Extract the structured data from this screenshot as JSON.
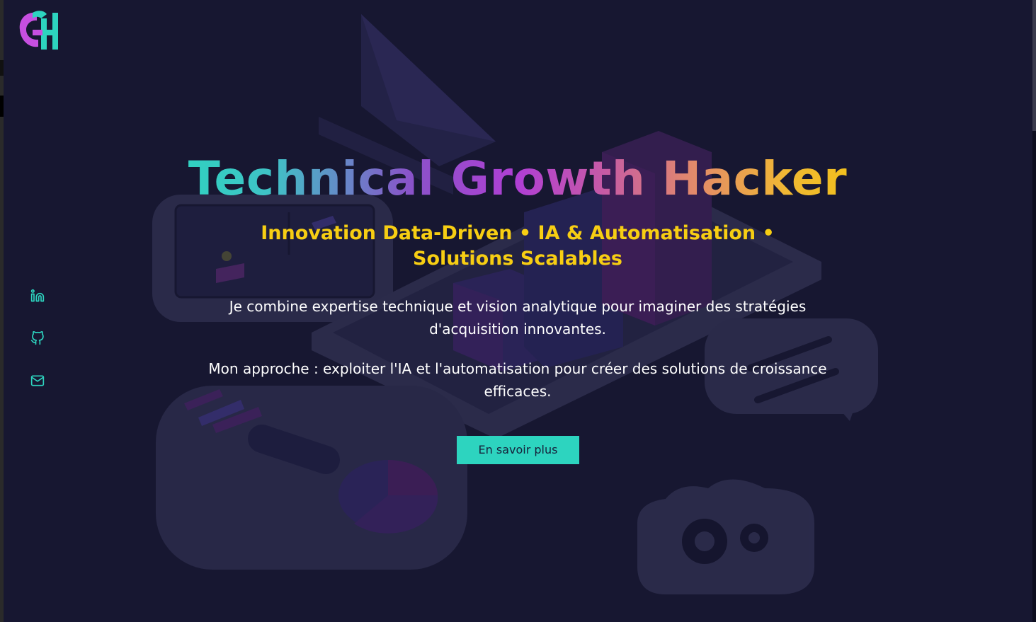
{
  "brand": {
    "logo_text": "GH",
    "logo_colors": [
      "#2dd4bf",
      "#c74fe0"
    ]
  },
  "social": [
    {
      "name": "linkedin-icon",
      "label": "LinkedIn"
    },
    {
      "name": "github-icon",
      "label": "GitHub"
    },
    {
      "name": "mail-icon",
      "label": "Email"
    }
  ],
  "hero": {
    "title": "Technical Growth Hacker",
    "subtitle": "Innovation Data-Driven • IA & Automatisation • Solutions Scalables",
    "paragraph_1": "Je combine expertise technique et vision analytique pour imaginer des stratégies d'acquisition innovantes.",
    "paragraph_2": "Mon approche : exploiter l'IA et l'automatisation pour créer des solutions de croissance efficaces.",
    "cta_label": "En savoir plus"
  },
  "colors": {
    "background": "#171731",
    "accent": "#2dd4bf",
    "subtitle": "#f7ce13",
    "gradient": [
      "#2dd4bf",
      "#b03fd4",
      "#f2c316"
    ]
  }
}
